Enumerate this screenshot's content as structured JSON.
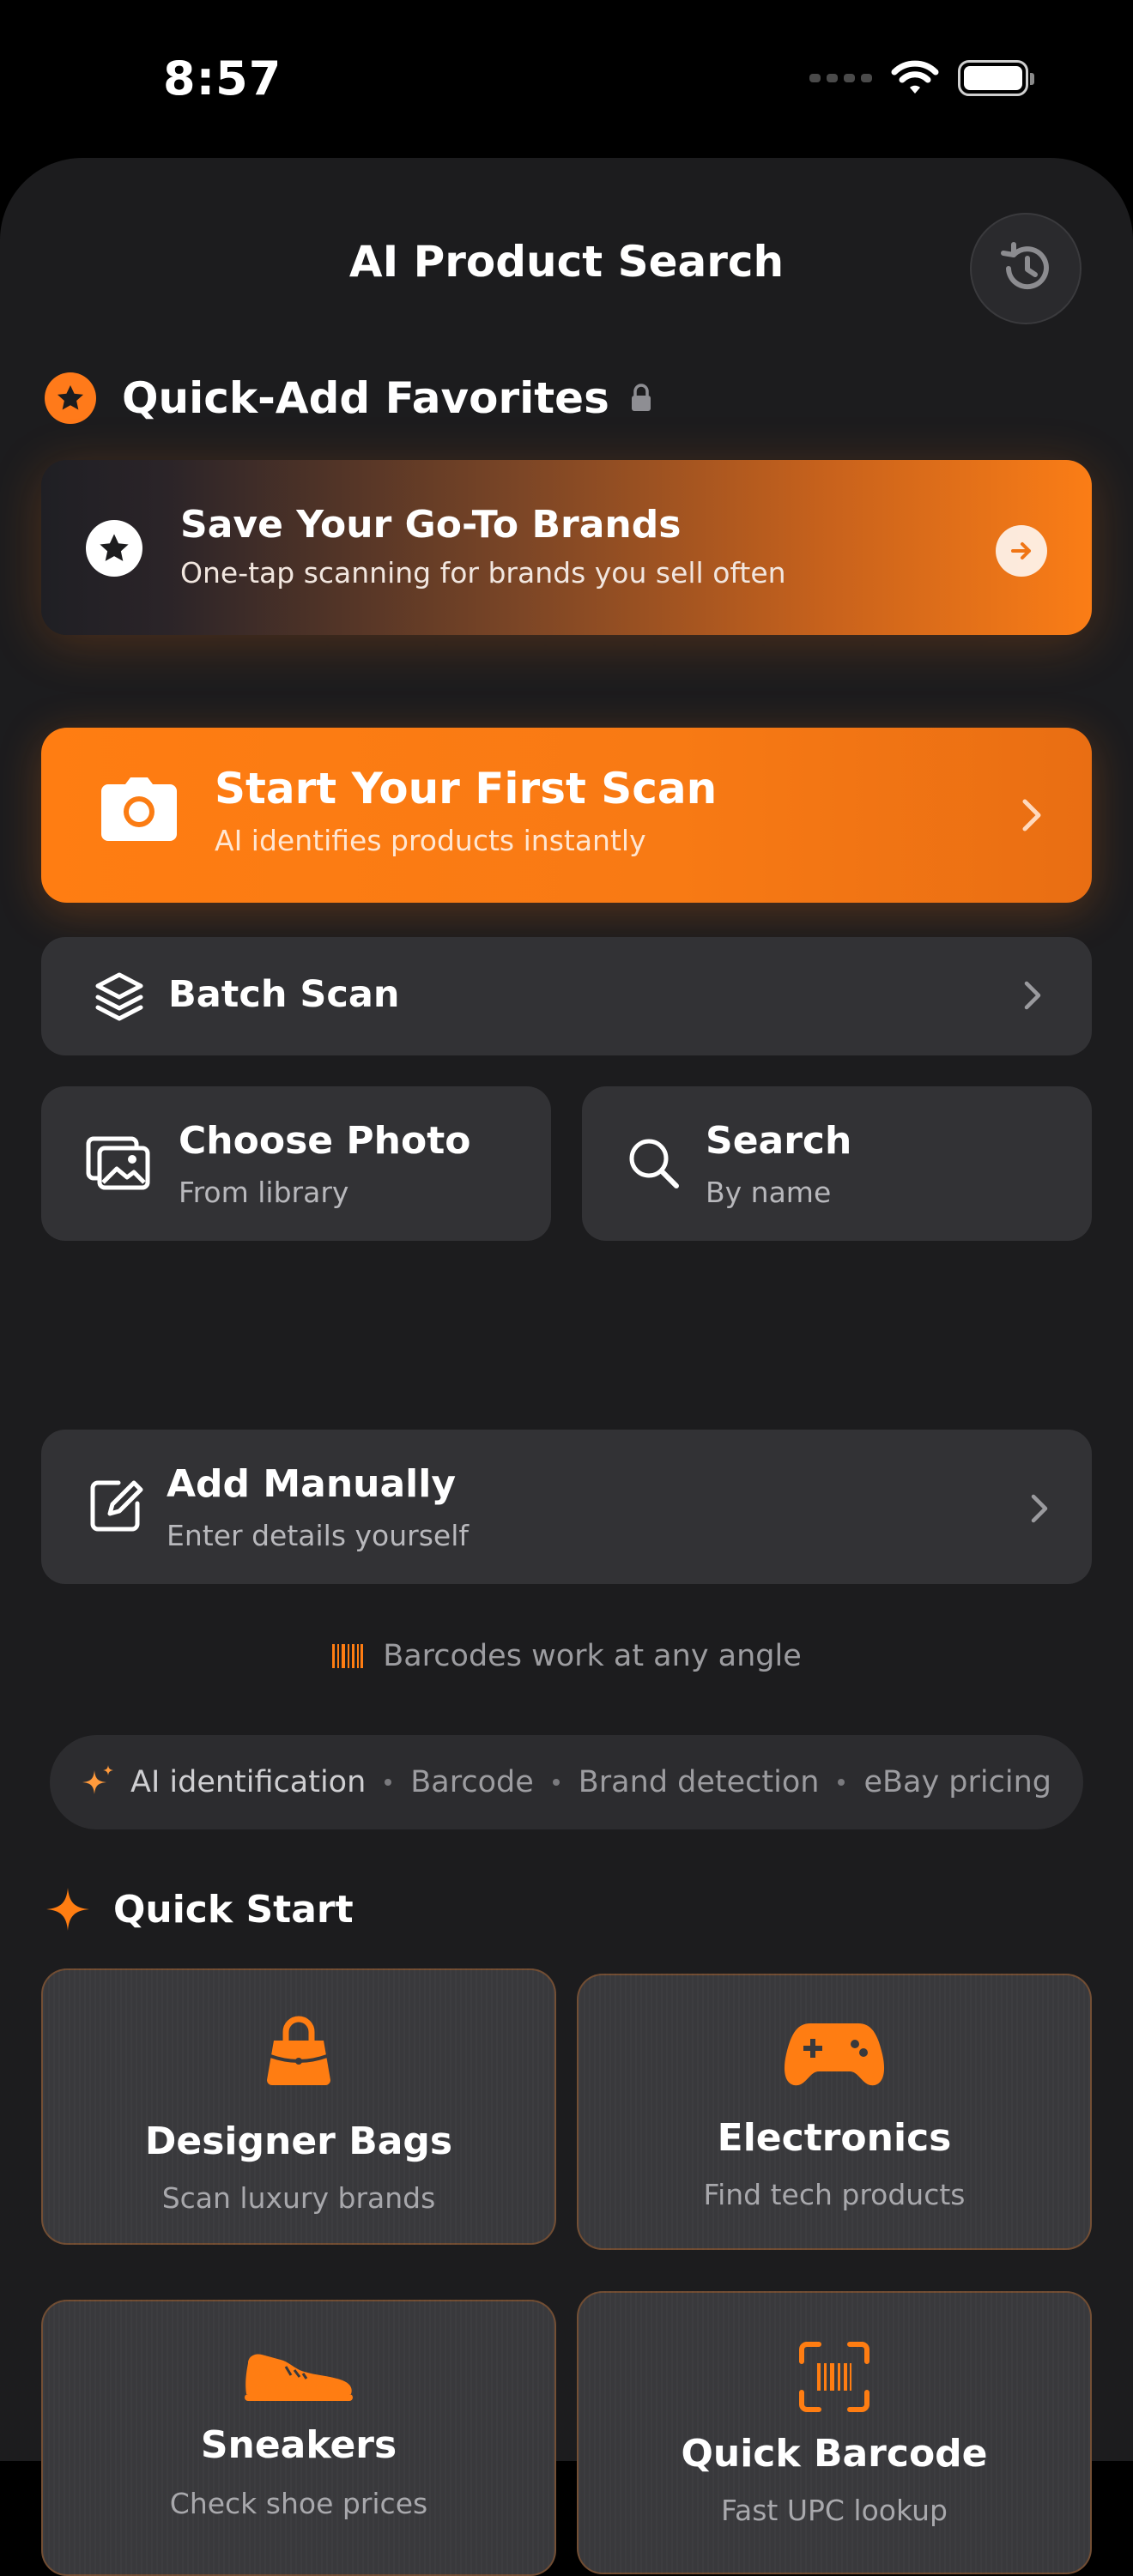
{
  "status": {
    "time": "8:57"
  },
  "header": {
    "title": "AI Product Search"
  },
  "favorites": {
    "section_title": "Quick-Add Favorites",
    "promo_title": "Save Your Go-To Brands",
    "promo_subtitle": "One-tap scanning for brands you sell often"
  },
  "scan": {
    "title": "Start Your First Scan",
    "subtitle": "AI identifies products instantly"
  },
  "batch": {
    "label": "Batch Scan"
  },
  "choose_photo": {
    "title": "Choose Photo",
    "subtitle": "From library"
  },
  "search": {
    "title": "Search",
    "subtitle": "By name"
  },
  "manual": {
    "title": "Add Manually",
    "subtitle": "Enter details yourself"
  },
  "hint": {
    "text": "Barcodes work at any angle"
  },
  "features": [
    "AI identification",
    "Barcode",
    "Brand detection",
    "eBay pricing"
  ],
  "quick_start": {
    "title": "Quick Start",
    "cards": [
      {
        "title": "Designer Bags",
        "subtitle": "Scan luxury brands",
        "icon": "handbag-icon"
      },
      {
        "title": "Electronics",
        "subtitle": "Find tech products",
        "icon": "gamecontroller-icon"
      },
      {
        "title": "Sneakers",
        "subtitle": "Check shoe prices",
        "icon": "sneaker-icon"
      },
      {
        "title": "Quick Barcode",
        "subtitle": "Fast UPC lookup",
        "icon": "barcode-viewfinder-icon"
      }
    ]
  },
  "colors": {
    "accent": "#ff7d12",
    "background": "#1c1c1e",
    "card": "#323235"
  }
}
